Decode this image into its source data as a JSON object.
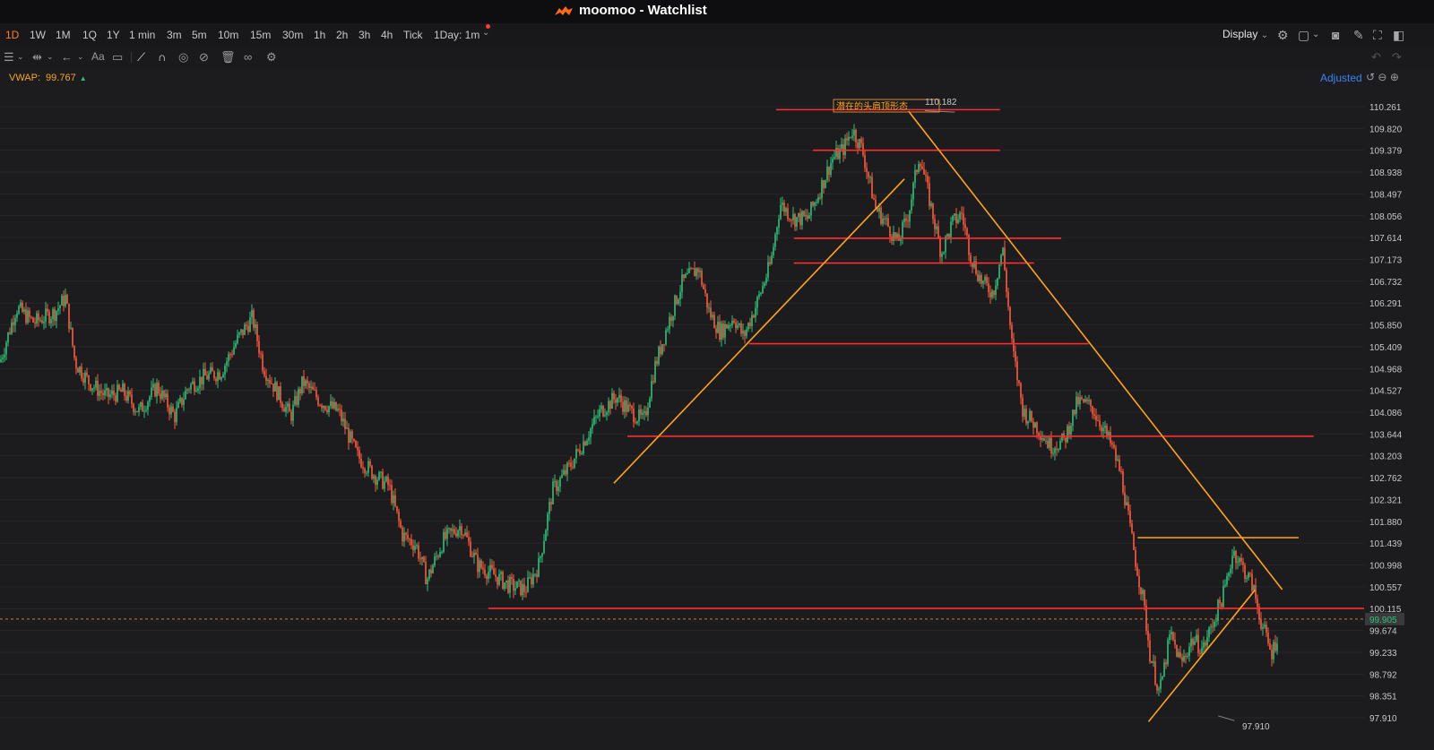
{
  "window": {
    "title": "moomoo - Watchlist"
  },
  "timeframes": [
    {
      "label": "1D",
      "active": true
    },
    {
      "label": "1W"
    },
    {
      "label": "1M"
    },
    {
      "label": "1Q"
    },
    {
      "label": "1Y"
    },
    {
      "label": "1 min"
    },
    {
      "label": "3m"
    },
    {
      "label": "5m"
    },
    {
      "label": "10m"
    },
    {
      "label": "15m"
    },
    {
      "label": "30m"
    },
    {
      "label": "1h"
    },
    {
      "label": "2h"
    },
    {
      "label": "3h"
    },
    {
      "label": "4h"
    },
    {
      "label": "Tick"
    },
    {
      "label": "1Day: 1m"
    }
  ],
  "toolbar": {
    "display_label": "Display"
  },
  "indicator": {
    "name": "VWAP:",
    "value": "99.767"
  },
  "adjusted_label": "Adjusted",
  "colors": {
    "up": "#2fc27a",
    "down": "#ff5a3c",
    "accent": "#ff7b1a",
    "hline": "#ff2d2d",
    "trend": "#ffa31a",
    "vwap": "#f5a623"
  },
  "price_axis": {
    "ticks": [
      "110.261",
      "109.820",
      "109.379",
      "108.938",
      "108.497",
      "108.056",
      "107.614",
      "107.173",
      "106.732",
      "106.291",
      "105.850",
      "105.409",
      "104.968",
      "104.527",
      "104.086",
      "103.644",
      "103.203",
      "102.762",
      "102.321",
      "101.880",
      "101.439",
      "100.998",
      "100.557",
      "100.115",
      "99.674",
      "99.233",
      "98.792",
      "98.351",
      "97.910"
    ],
    "current_price": "99.905"
  },
  "annotations": {
    "pattern_label": "潜在的头肩顶形态",
    "high_label": "110.182",
    "low_label": "97.910"
  },
  "chart_data": {
    "type": "candlestick",
    "title": "",
    "ylim": [
      97.7,
      110.5
    ],
    "high": 110.182,
    "low": 97.91,
    "current": 99.905,
    "vwap": 99.767,
    "horizontal_levels": [
      110.2,
      109.38,
      107.6,
      107.1,
      105.47,
      103.6,
      100.12,
      101.55
    ],
    "trendlines": [
      {
        "from": [
          0.45,
          102.65
        ],
        "to": [
          0.663,
          108.8
        ]
      },
      {
        "from": [
          0.666,
          110.17
        ],
        "to": [
          0.94,
          100.5
        ]
      },
      {
        "from": [
          0.842,
          97.83
        ],
        "to": [
          0.92,
          100.49
        ]
      }
    ],
    "close_path": [
      [
        0.0,
        105.1
      ],
      [
        0.012,
        106.2
      ],
      [
        0.025,
        105.9
      ],
      [
        0.04,
        106.1
      ],
      [
        0.048,
        106.4
      ],
      [
        0.055,
        105.1
      ],
      [
        0.065,
        104.7
      ],
      [
        0.078,
        104.4
      ],
      [
        0.09,
        104.5
      ],
      [
        0.102,
        104.1
      ],
      [
        0.115,
        104.6
      ],
      [
        0.128,
        104.0
      ],
      [
        0.138,
        104.6
      ],
      [
        0.15,
        104.8
      ],
      [
        0.162,
        104.9
      ],
      [
        0.175,
        105.6
      ],
      [
        0.185,
        106.0
      ],
      [
        0.193,
        105.0
      ],
      [
        0.203,
        104.5
      ],
      [
        0.213,
        104.0
      ],
      [
        0.222,
        104.7
      ],
      [
        0.235,
        104.3
      ],
      [
        0.248,
        104.1
      ],
      [
        0.262,
        103.2
      ],
      [
        0.275,
        102.8
      ],
      [
        0.285,
        102.6
      ],
      [
        0.295,
        101.6
      ],
      [
        0.305,
        101.4
      ],
      [
        0.313,
        100.7
      ],
      [
        0.325,
        101.5
      ],
      [
        0.338,
        101.8
      ],
      [
        0.35,
        101.0
      ],
      [
        0.362,
        100.8
      ],
      [
        0.372,
        100.6
      ],
      [
        0.385,
        100.5
      ],
      [
        0.395,
        101.0
      ],
      [
        0.405,
        102.5
      ],
      [
        0.418,
        103.0
      ],
      [
        0.428,
        103.5
      ],
      [
        0.44,
        104.1
      ],
      [
        0.452,
        104.4
      ],
      [
        0.462,
        104.1
      ],
      [
        0.472,
        103.9
      ],
      [
        0.48,
        105.0
      ],
      [
        0.49,
        105.9
      ],
      [
        0.5,
        106.7
      ],
      [
        0.512,
        107.0
      ],
      [
        0.52,
        106.1
      ],
      [
        0.528,
        105.7
      ],
      [
        0.538,
        106.0
      ],
      [
        0.545,
        105.6
      ],
      [
        0.555,
        106.3
      ],
      [
        0.565,
        107.1
      ],
      [
        0.572,
        108.3
      ],
      [
        0.582,
        108.0
      ],
      [
        0.592,
        108.0
      ],
      [
        0.6,
        108.5
      ],
      [
        0.61,
        109.2
      ],
      [
        0.618,
        109.4
      ],
      [
        0.625,
        109.8
      ],
      [
        0.632,
        109.4
      ],
      [
        0.642,
        108.2
      ],
      [
        0.65,
        107.9
      ],
      [
        0.658,
        107.5
      ],
      [
        0.666,
        108.1
      ],
      [
        0.674,
        109.3
      ],
      [
        0.682,
        108.3
      ],
      [
        0.69,
        107.3
      ],
      [
        0.698,
        107.9
      ],
      [
        0.705,
        108.1
      ],
      [
        0.712,
        107.2
      ],
      [
        0.72,
        106.7
      ],
      [
        0.728,
        106.5
      ],
      [
        0.735,
        107.4
      ],
      [
        0.742,
        105.4
      ],
      [
        0.75,
        104.1
      ],
      [
        0.76,
        103.8
      ],
      [
        0.77,
        103.4
      ],
      [
        0.78,
        103.5
      ],
      [
        0.79,
        104.3
      ],
      [
        0.8,
        104.2
      ],
      [
        0.808,
        103.8
      ],
      [
        0.815,
        103.4
      ],
      [
        0.822,
        102.8
      ],
      [
        0.828,
        101.8
      ],
      [
        0.833,
        101.0
      ],
      [
        0.838,
        100.3
      ],
      [
        0.843,
        99.2
      ],
      [
        0.85,
        98.4
      ],
      [
        0.858,
        99.6
      ],
      [
        0.866,
        99.0
      ],
      [
        0.874,
        99.5
      ],
      [
        0.882,
        99.3
      ],
      [
        0.89,
        99.9
      ],
      [
        0.898,
        100.5
      ],
      [
        0.904,
        101.3
      ],
      [
        0.91,
        101.0
      ],
      [
        0.918,
        100.6
      ],
      [
        0.925,
        99.8
      ],
      [
        0.932,
        99.2
      ],
      [
        0.937,
        99.6
      ]
    ]
  }
}
